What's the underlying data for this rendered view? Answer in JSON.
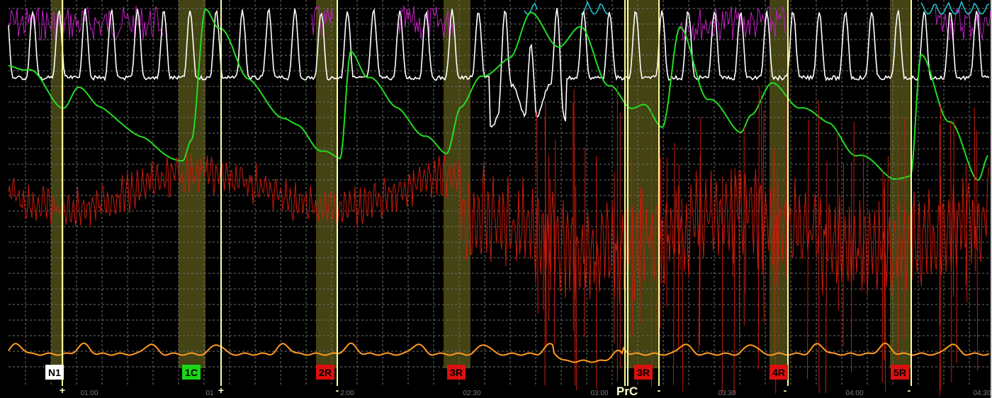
{
  "colors": {
    "background": "#000000",
    "grid": "#6f6f6f",
    "shade": "#5a5a1a",
    "marker_line": "#ffff99",
    "white_trace": "#ffffff",
    "magenta_trace": "#c020c0",
    "green_trace": "#22dd22",
    "red_trace": "#cc1a0a",
    "orange_trace": "#ff9a22",
    "cyan_trace": "#22c8d8"
  },
  "time_ticks": [
    "01:00",
    "01",
    "2:00",
    "02:30",
    "03:00",
    "03:30",
    "04:00",
    "04:30"
  ],
  "events": [
    {
      "label": "N1",
      "bg": "#ffffff",
      "fg": "#000000",
      "sign": "+"
    },
    {
      "label": "1C",
      "bg": "#18d818",
      "fg": "#000000",
      "sign": "+"
    },
    {
      "label": "2R",
      "bg": "#dd1010",
      "fg": "#000000",
      "sign": "-"
    },
    {
      "label": "3R",
      "bg": "#dd1010",
      "fg": "#000000",
      "sign": ""
    },
    {
      "label": "3R",
      "bg": "#dd1010",
      "fg": "#000000",
      "sign": "-"
    },
    {
      "label": "4R",
      "bg": "#dd1010",
      "fg": "#000000",
      "sign": "-"
    },
    {
      "label": "5R",
      "bg": "#dd1010",
      "fg": "#000000",
      "sign": "-"
    }
  ],
  "prc_label": "PrC",
  "prc_sign": "-"
}
